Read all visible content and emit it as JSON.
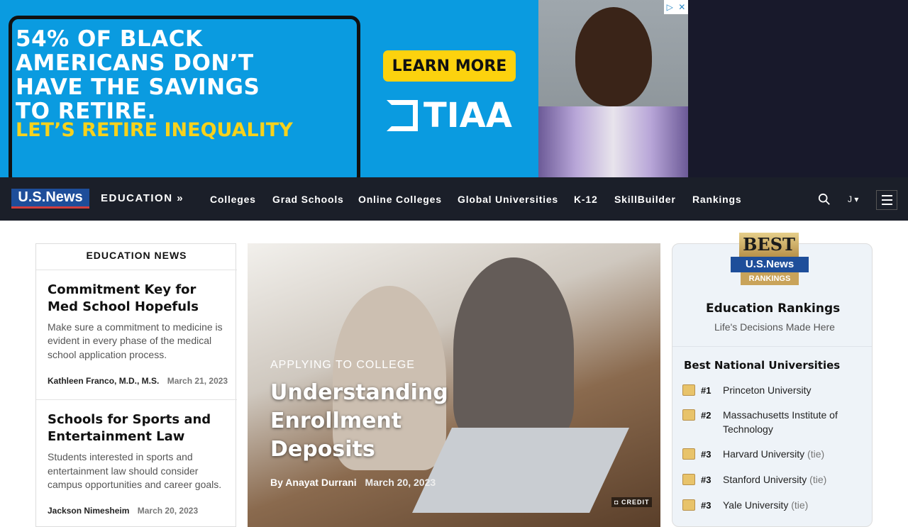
{
  "ad": {
    "lines": [
      "54% OF BLACK",
      "AMERICANS DON’T",
      "HAVE THE SAVINGS",
      "TO RETIRE."
    ],
    "tagline": "LET’S RETIRE INEQUALITY",
    "cta": "LEARN MORE",
    "brand": "TIAA"
  },
  "nav": {
    "logo": "U.S.News",
    "section": "EDUCATION »",
    "links": [
      "Colleges",
      "Grad Schools",
      "Online Colleges",
      "Global Universities",
      "K-12",
      "SkillBuilder",
      "Rankings"
    ],
    "user": "J"
  },
  "left": {
    "title": "EDUCATION NEWS",
    "articles": [
      {
        "headline_1": "Commitment Key for",
        "headline_2": "Med School Hopefuls",
        "summary_1": "Make sure a commitment to medicine is",
        "summary_2": "evident in every phase of the medical",
        "summary_3": "school application process.",
        "author": "Kathleen Franco, M.D., M.S.",
        "date": "March 21, 2023"
      },
      {
        "headline_1": "Schools for Sports and",
        "headline_2": "Entertainment Law",
        "summary_1": "Students interested in sports and",
        "summary_2": "entertainment law should consider",
        "summary_3": "campus opportunities and career goals.",
        "author": "Jackson Nimesheim",
        "date": "March 20, 2023"
      }
    ]
  },
  "hero": {
    "category": "APPLYING TO COLLEGE",
    "title_1": "Understanding",
    "title_2": "Enrollment",
    "title_3": "Deposits",
    "by": "By",
    "author": "Anayat Durrani",
    "date": "March 20, 2023",
    "credit": "CREDIT"
  },
  "right": {
    "badge_best": "BEST",
    "badge_brand": "U.S.News",
    "badge_rankings": "RANKINGS",
    "title": "Education Rankings",
    "subtitle": "Life's Decisions Made Here",
    "list_title": "Best National Universities",
    "items": [
      {
        "rank": "#1",
        "name": "Princeton University",
        "tie": ""
      },
      {
        "rank": "#2",
        "name": "Massachusetts Institute of Technology",
        "tie": ""
      },
      {
        "rank": "#3",
        "name": "Harvard University",
        "tie": "(tie)"
      },
      {
        "rank": "#3",
        "name": "Stanford University",
        "tie": "(tie)"
      },
      {
        "rank": "#3",
        "name": "Yale University",
        "tie": "(tie)"
      }
    ]
  }
}
